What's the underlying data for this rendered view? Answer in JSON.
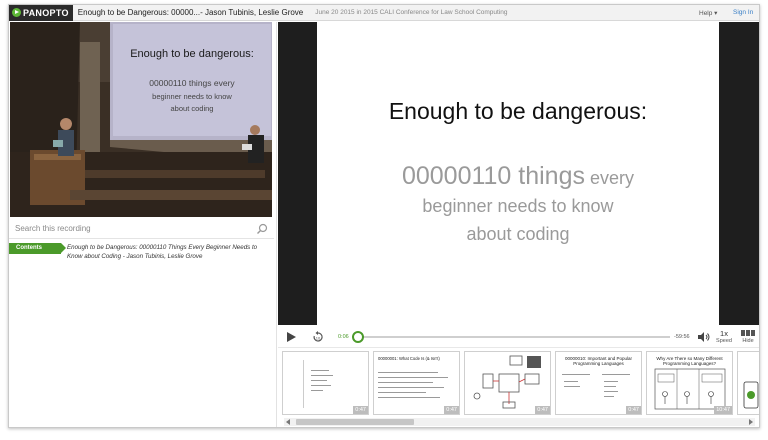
{
  "header": {
    "logo_text": "PANOPTO",
    "title": "Enough to be Dangerous: 00000...- Jason Tubinis, Leslie Grove",
    "subtitle": "June 20 2015 in 2015 CALI Conference for Law School Computing",
    "help_label": "Help ▾",
    "signin_label": "Sign In"
  },
  "video": {
    "screen_title": "Enough to be dangerous:",
    "screen_line1": "00000110 things every",
    "screen_line2": "beginner needs to know",
    "screen_line3": "about coding"
  },
  "search": {
    "placeholder": "Search this recording"
  },
  "contents": {
    "tab_label": "Contents",
    "entry": "Enough to be Dangerous: 00000110 Things Every Beginner Needs to Know about Coding - Jason Tubinis, Leslie Grove"
  },
  "slide": {
    "title": "Enough to be dangerous:",
    "sub_big": "00000110 things",
    "sub_small1": " every",
    "sub_line2": "beginner needs to know",
    "sub_line3": "about coding"
  },
  "player": {
    "current_time": "0:06",
    "remaining_time": "-59:56",
    "progress": 0.002,
    "speed_value": "1x",
    "speed_label": "Speed",
    "hide_label": "Hide"
  },
  "thumbnails": [
    {
      "title": "",
      "duration": "0:47"
    },
    {
      "title": "00000001: What Code Is (& Isn't)",
      "duration": "0:47"
    },
    {
      "title": "",
      "duration": "0:47"
    },
    {
      "title": "00000010: Important and Popular Programming Languages",
      "duration": "0:47"
    },
    {
      "title": "Why Are There so Many Different Programming Languages?",
      "duration": "10:47"
    }
  ],
  "colors": {
    "accent": "#4b9a2a",
    "link": "#3a7fc6"
  }
}
